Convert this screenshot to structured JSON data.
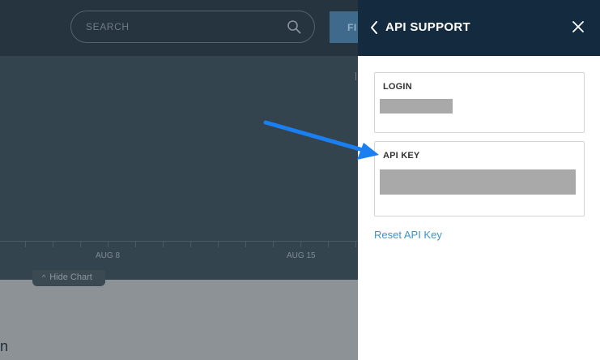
{
  "header": {
    "search": {
      "placeholder": "SEARCH",
      "icon": "search-icon"
    },
    "find_button_label": "FI"
  },
  "chart": {
    "tick_labels": [
      "AUG 8",
      "AUG 15"
    ],
    "hide_chart_label": "Hide Chart"
  },
  "lower": {
    "partial_text": "n"
  },
  "panel": {
    "title": "API SUPPORT",
    "fields": [
      {
        "label": "LOGIN",
        "value_redacted": true
      },
      {
        "label": "API KEY",
        "value_redacted": true
      }
    ],
    "reset_label": "Reset API Key"
  },
  "colors": {
    "panel_header": "#142b3f",
    "app_header": "#26343f",
    "chart_bg": "#34444f",
    "link": "#3b95c8",
    "arrow": "#1a7ff0",
    "redaction": "#a9a9a9"
  }
}
